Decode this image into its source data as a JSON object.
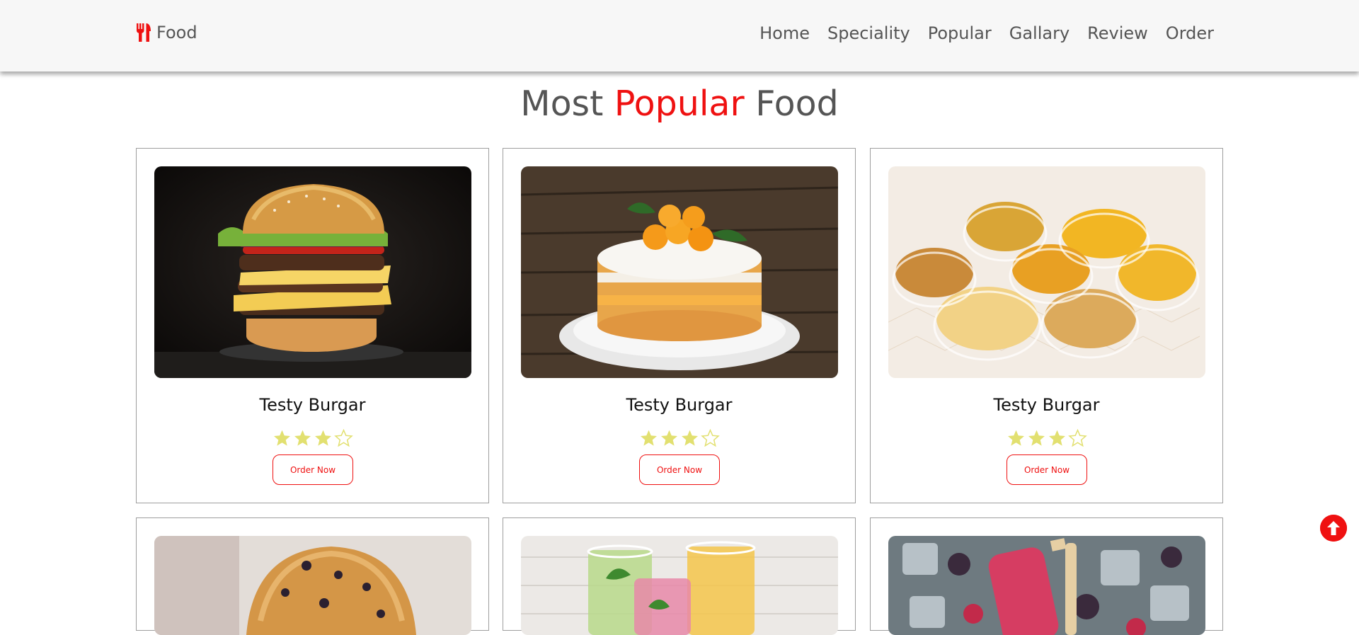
{
  "brand": {
    "label": "Food",
    "icon": "utensils-icon"
  },
  "nav": {
    "items": [
      {
        "label": "Home"
      },
      {
        "label": "Speciality"
      },
      {
        "label": "Popular"
      },
      {
        "label": "Gallary"
      },
      {
        "label": "Review"
      },
      {
        "label": "Order"
      }
    ]
  },
  "section": {
    "title_part1": "Most",
    "title_accent": "Popular",
    "title_part2": "Food"
  },
  "cards": [
    {
      "title": "Testy Burgar",
      "rating": 3,
      "rating_max": 5,
      "button": "Order Now",
      "image": "burger-image"
    },
    {
      "title": "Testy Burgar",
      "rating": 3,
      "rating_max": 5,
      "button": "Order Now",
      "image": "cake-image"
    },
    {
      "title": "Testy Burgar",
      "rating": 3,
      "rating_max": 5,
      "button": "Order Now",
      "image": "snacks-image"
    },
    {
      "image": "muffin-image"
    },
    {
      "image": "juice-image"
    },
    {
      "image": "popsicle-image"
    }
  ],
  "colors": {
    "accent": "#ef1111",
    "text": "#555555",
    "star": "#e2e070",
    "navbar_bg": "#f7f7f7"
  },
  "scroll_top": {
    "icon": "arrow-up-circle-icon"
  }
}
